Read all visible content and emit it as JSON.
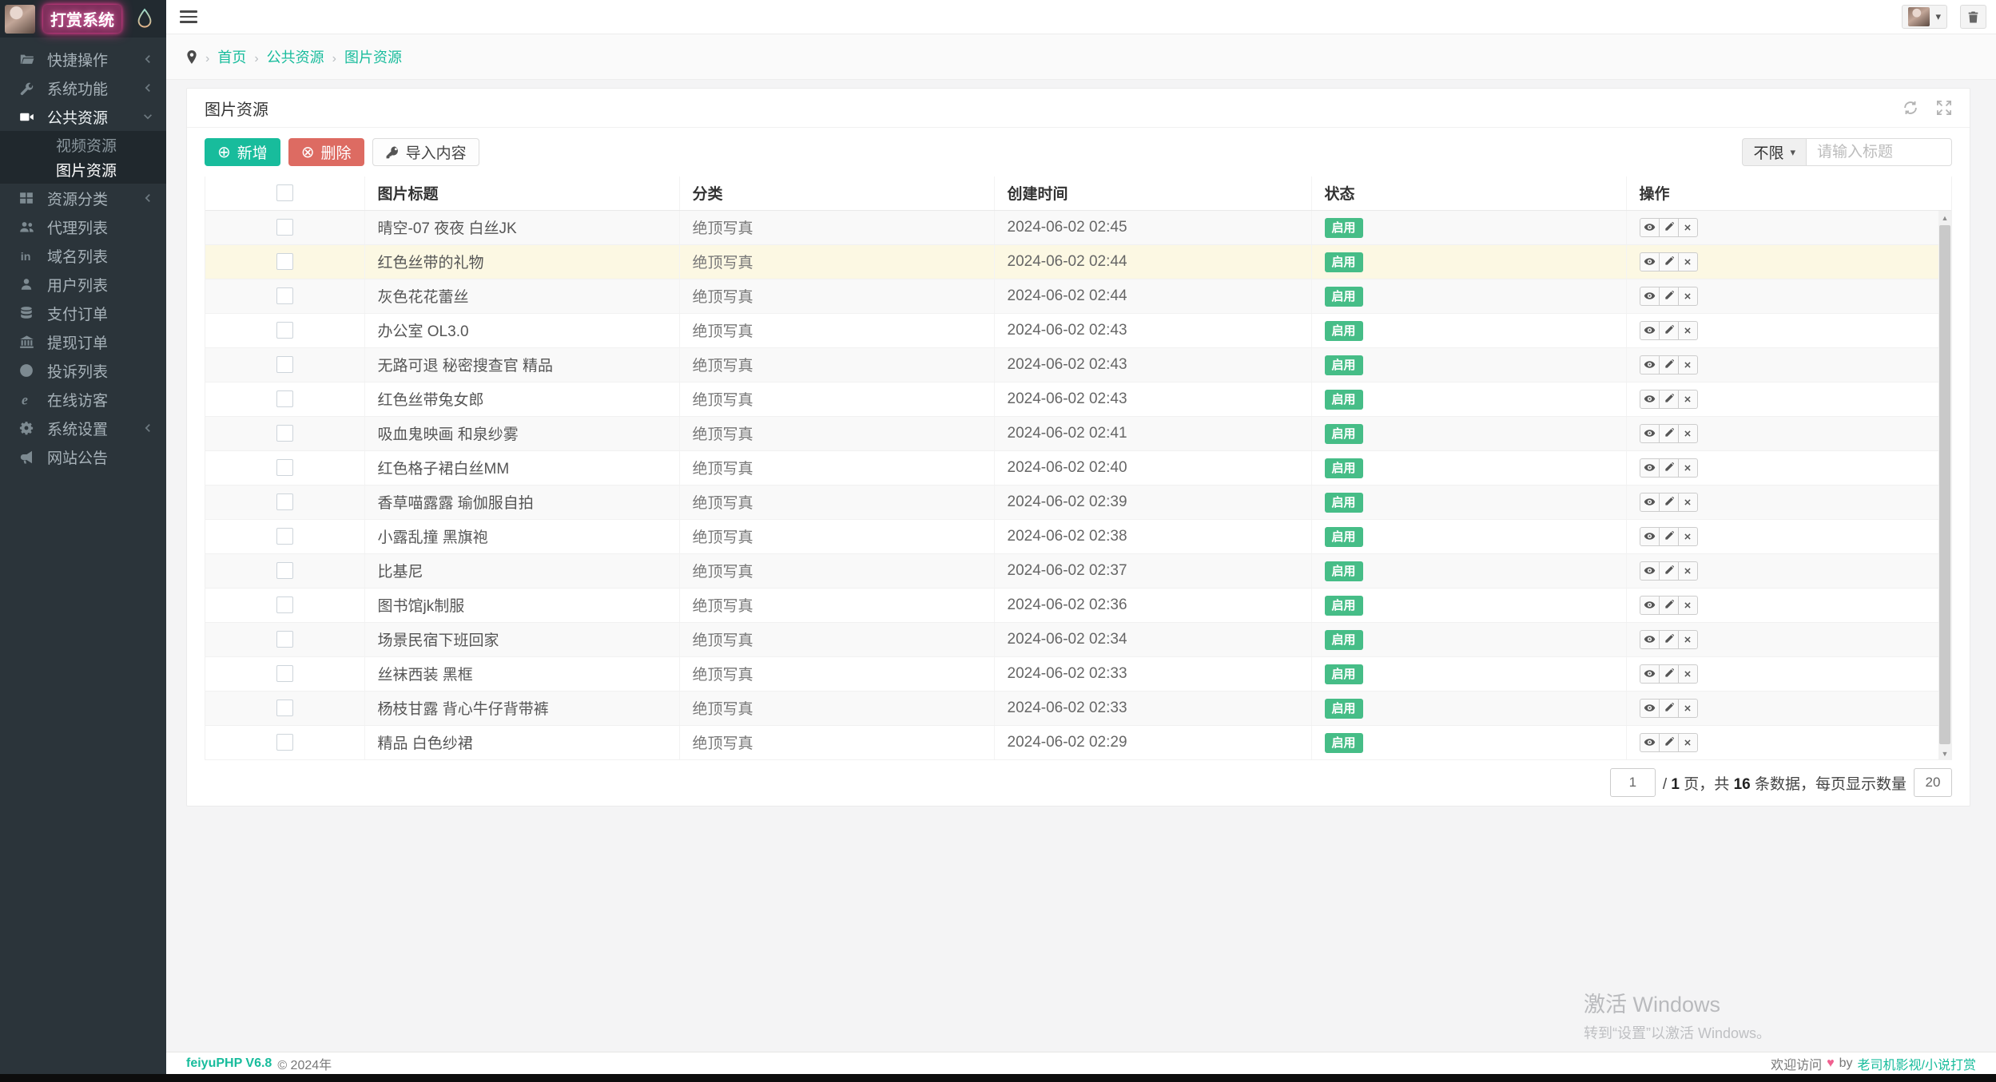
{
  "colors": {
    "accent": "#18bc9c",
    "danger": "#dd6b62",
    "badge_success": "#46bd87",
    "sidebar_bg": "#2b343a"
  },
  "sidebar": {
    "logo": {
      "title": "打赏系统",
      "avatar_icon": "avatar-image",
      "drop_icon": "water-drop-icon"
    },
    "items": [
      {
        "label": "快捷操作",
        "icon": "folder-open-icon",
        "has_children": true
      },
      {
        "label": "系统功能",
        "icon": "wrench-icon",
        "has_children": true
      },
      {
        "label": "公共资源",
        "icon": "video-camera-icon",
        "has_children": true,
        "expanded": true,
        "active": true,
        "children": [
          {
            "label": "视频资源"
          },
          {
            "label": "图片资源",
            "active": true
          }
        ]
      },
      {
        "label": "资源分类",
        "icon": "grid-icon",
        "has_children": true
      },
      {
        "label": "代理列表",
        "icon": "users-icon"
      },
      {
        "label": "域名列表",
        "icon": "linkedin-icon"
      },
      {
        "label": "用户列表",
        "icon": "user-icon"
      },
      {
        "label": "支付订单",
        "icon": "database-icon"
      },
      {
        "label": "提现订单",
        "icon": "bank-icon"
      },
      {
        "label": "投诉列表",
        "icon": "exclamation-circle-icon"
      },
      {
        "label": "在线访客",
        "icon": "internet-explorer-icon"
      },
      {
        "label": "系统设置",
        "icon": "gear-icon",
        "has_children": true
      },
      {
        "label": "网站公告",
        "icon": "bullhorn-icon"
      }
    ]
  },
  "navbar": {
    "breadcrumb": [
      "首页",
      "公共资源",
      "图片资源"
    ],
    "separator": "›",
    "user_caret": "▾"
  },
  "panel": {
    "title": "图片资源"
  },
  "toolbar": {
    "add_label": "新增",
    "add_glyph": "⊕",
    "delete_label": "删除",
    "delete_glyph": "⊗",
    "import_label": "导入内容",
    "filter_label": "不限",
    "filter_caret": "▾",
    "search_placeholder": "请输入标题"
  },
  "table": {
    "headers": [
      "图片标题",
      "分类",
      "创建时间",
      "状态",
      "操作"
    ],
    "rows": [
      {
        "title": "晴空-07 夜夜 白丝JK",
        "category": "绝顶写真",
        "created": "2024-06-02 02:45",
        "status": "启用"
      },
      {
        "title": "红色丝带的礼物",
        "category": "绝顶写真",
        "created": "2024-06-02 02:44",
        "status": "启用",
        "highlighted": true
      },
      {
        "title": "灰色花花蕾丝",
        "category": "绝顶写真",
        "created": "2024-06-02 02:44",
        "status": "启用"
      },
      {
        "title": "办公室 OL3.0",
        "category": "绝顶写真",
        "created": "2024-06-02 02:43",
        "status": "启用"
      },
      {
        "title": "无路可退 秘密搜查官 精品",
        "category": "绝顶写真",
        "created": "2024-06-02 02:43",
        "status": "启用"
      },
      {
        "title": "红色丝带兔女郎",
        "category": "绝顶写真",
        "created": "2024-06-02 02:43",
        "status": "启用"
      },
      {
        "title": "吸血鬼映画 和泉纱雾",
        "category": "绝顶写真",
        "created": "2024-06-02 02:41",
        "status": "启用"
      },
      {
        "title": "红色格子裙白丝MM",
        "category": "绝顶写真",
        "created": "2024-06-02 02:40",
        "status": "启用"
      },
      {
        "title": "香草喵露露 瑜伽服自拍",
        "category": "绝顶写真",
        "created": "2024-06-02 02:39",
        "status": "启用"
      },
      {
        "title": "小露乱撞 黑旗袍",
        "category": "绝顶写真",
        "created": "2024-06-02 02:38",
        "status": "启用"
      },
      {
        "title": "比基尼",
        "category": "绝顶写真",
        "created": "2024-06-02 02:37",
        "status": "启用"
      },
      {
        "title": "图书馆jk制服",
        "category": "绝顶写真",
        "created": "2024-06-02 02:36",
        "status": "启用"
      },
      {
        "title": "场景民宿下班回家",
        "category": "绝顶写真",
        "created": "2024-06-02 02:34",
        "status": "启用"
      },
      {
        "title": "丝袜西装 黑框",
        "category": "绝顶写真",
        "created": "2024-06-02 02:33",
        "status": "启用"
      },
      {
        "title": "杨枝甘露 背心牛仔背带裤",
        "category": "绝顶写真",
        "created": "2024-06-02 02:33",
        "status": "启用"
      },
      {
        "title": "精品 白色纱裙",
        "category": "绝顶写真",
        "created": "2024-06-02 02:29",
        "status": "启用"
      }
    ]
  },
  "pagination": {
    "page_value": "1",
    "slash": "/",
    "pages_bold": "1",
    "seg1": "页，共",
    "count_bold": "16",
    "seg2": "条数据，每页显示数量",
    "page_size_value": "20"
  },
  "footer": {
    "brand": "feiyuPHP V6.8",
    "copyright": "© 2024年",
    "welcome": "欢迎访问",
    "heart": "♥",
    "by": "by",
    "link": "老司机影视/小说打赏"
  },
  "watermark": {
    "line1": "激活 Windows",
    "line2": "转到“设置”以激活 Windows。"
  }
}
